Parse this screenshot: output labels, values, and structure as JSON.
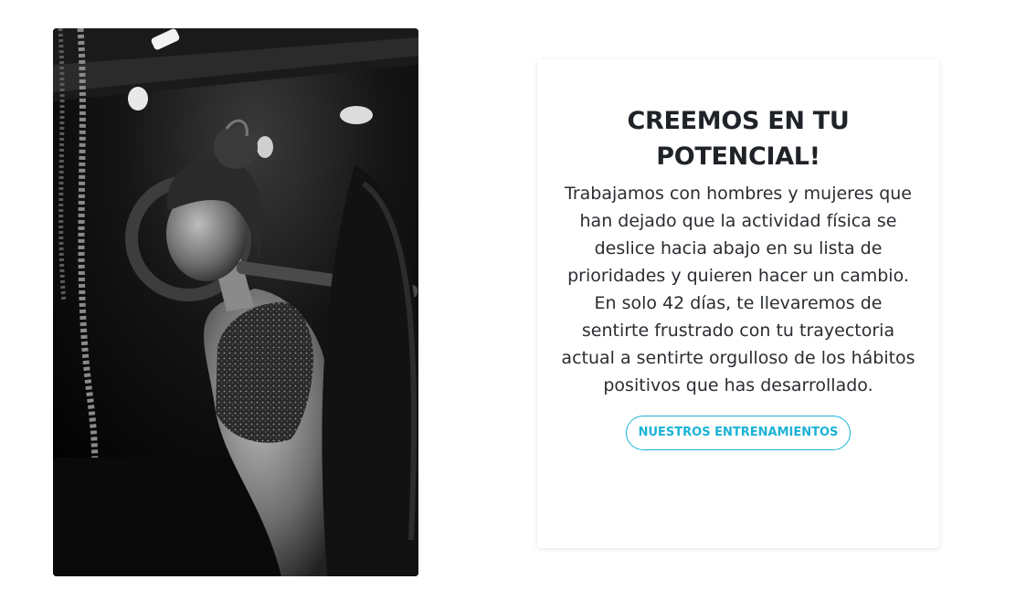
{
  "hero": {
    "image_alt": "Mujer en blanco y negro levantando una barra en el gimnasio"
  },
  "card": {
    "title": "CREEMOS EN TU POTENCIAL!",
    "body": "Trabajamos con hombres y mujeres que han dejado que la actividad física se deslice hacia abajo en su lista de prioridades y quieren hacer un cambio. En solo 42 días, te llevaremos de sentirte frustrado con tu trayectoria actual a sentirte orgulloso de los hábitos positivos que has desarrollado.",
    "button_label": "NUESTROS ENTRENAMIENTOS"
  },
  "colors": {
    "accent": "#1bb3d6",
    "title": "#1f2328",
    "text": "#2a2d31"
  }
}
